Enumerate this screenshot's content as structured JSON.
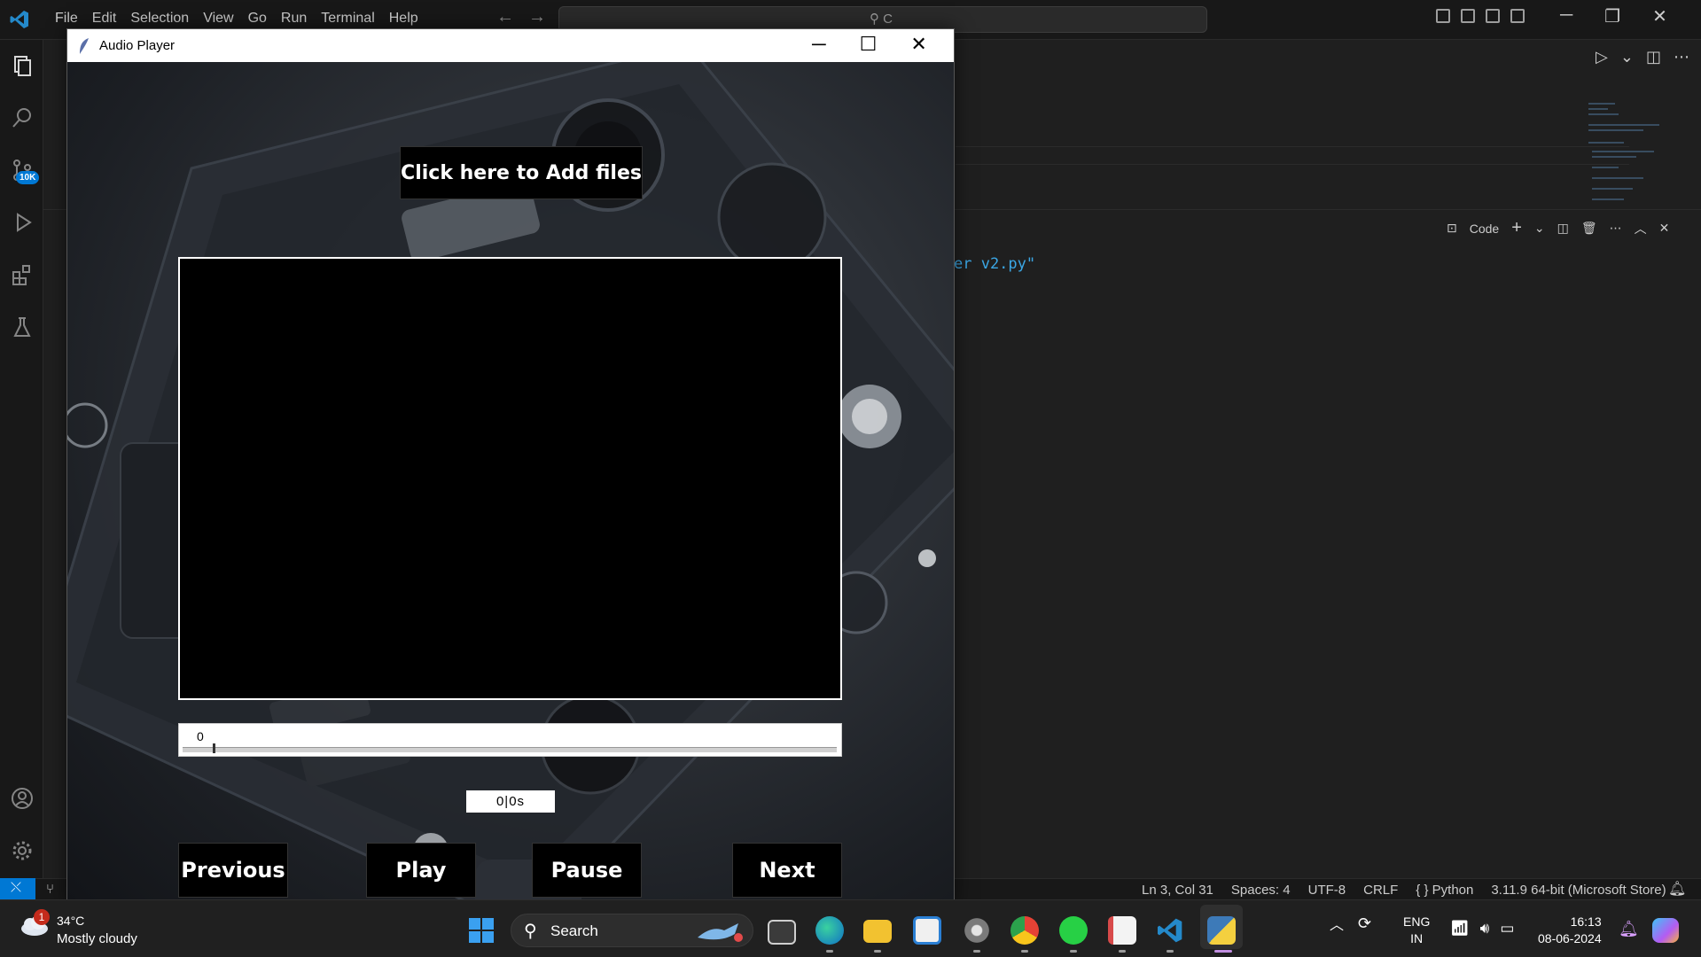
{
  "vscode": {
    "menu": [
      "File",
      "Edit",
      "Selection",
      "View",
      "Go",
      "Run",
      "Terminal",
      "Help"
    ],
    "command_center_text": "C",
    "scm_badge": "10K",
    "terminal_fragment": "er v2.py\"",
    "terminal_profile": "Code",
    "status": {
      "position": "Ln 3, Col 31",
      "spaces": "Spaces: 4",
      "encoding": "UTF-8",
      "eol": "CRLF",
      "language": "Python",
      "interpreter": "3.11.9 64-bit (Microsoft Store)"
    },
    "accent": "#0078d4"
  },
  "audio_player": {
    "title": "Audio Player",
    "add_files_label": "Click here to Add files",
    "seek_value": "0",
    "time_label": "0|0s",
    "buttons": {
      "previous": "Previous",
      "play": "Play",
      "pause": "Pause",
      "next": "Next"
    }
  },
  "taskbar": {
    "weather_badge": "1",
    "weather_temp": "34°C",
    "weather_desc": "Mostly cloudy",
    "search_label": "Search",
    "lang_line1": "ENG",
    "lang_line2": "IN",
    "time": "16:13",
    "date": "08-06-2024",
    "apps": [
      "task-view-icon",
      "edge-icon",
      "file-explorer-icon",
      "store-icon",
      "settings-icon",
      "chrome-icon",
      "whatsapp-icon",
      "snipping-tool-icon",
      "vscode-icon",
      "python-icon"
    ]
  }
}
